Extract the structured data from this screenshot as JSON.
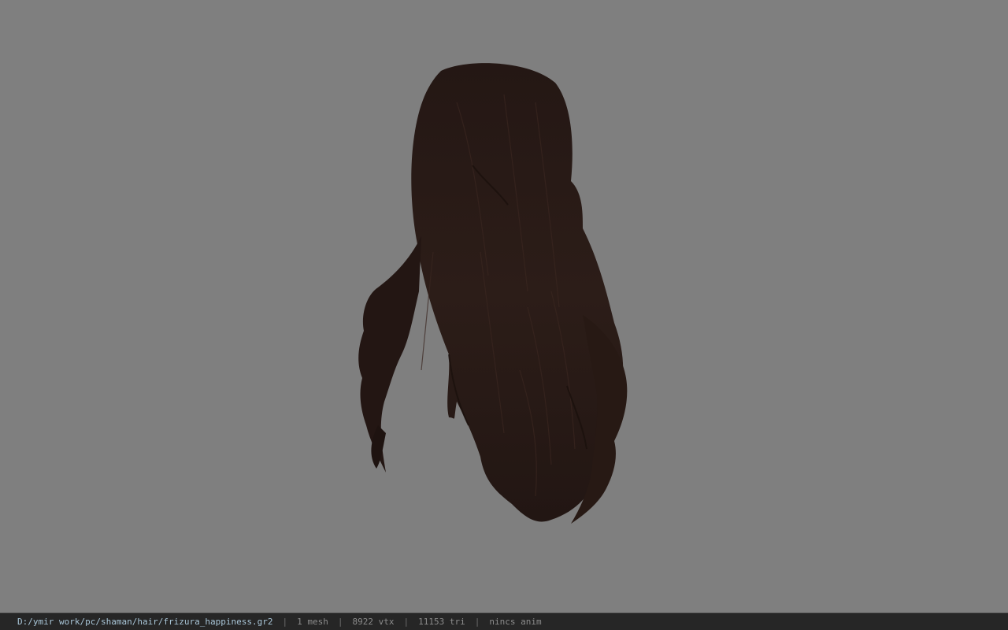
{
  "viewer": {
    "background_color": "#7f7f7f",
    "model_color": "#2a1b17"
  },
  "status_bar": {
    "file_path": "D:/ymir work/pc/shaman/hair/frizura_happiness.gr2",
    "separator": "|",
    "mesh_count": "1 mesh",
    "vertex_count": "8922 vtx",
    "triangle_count": "11153 tri",
    "animation_info": "nincs anim"
  }
}
